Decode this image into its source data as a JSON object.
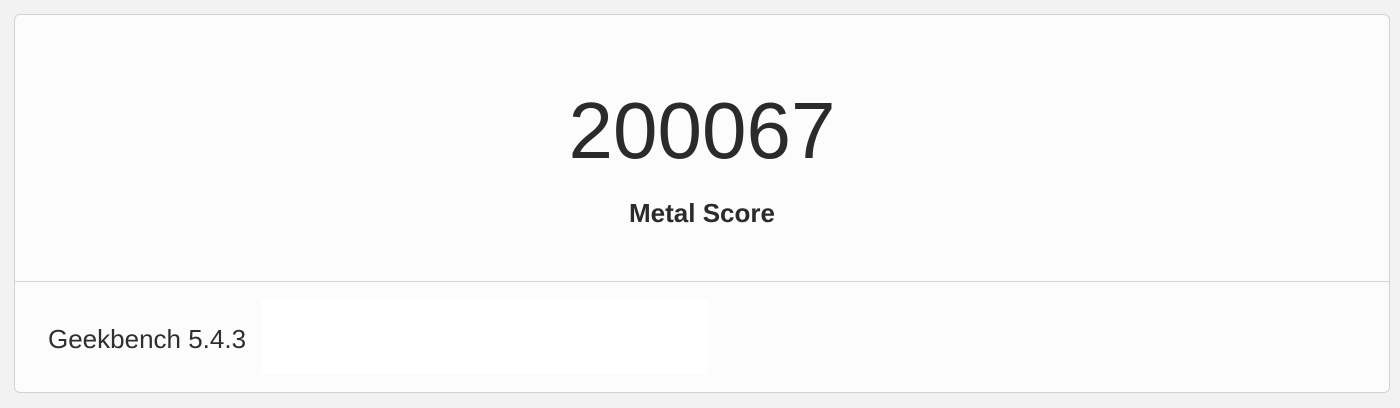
{
  "score": {
    "value": "200067",
    "label": "Metal Score"
  },
  "footer": {
    "version": "Geekbench 5.4.3"
  }
}
